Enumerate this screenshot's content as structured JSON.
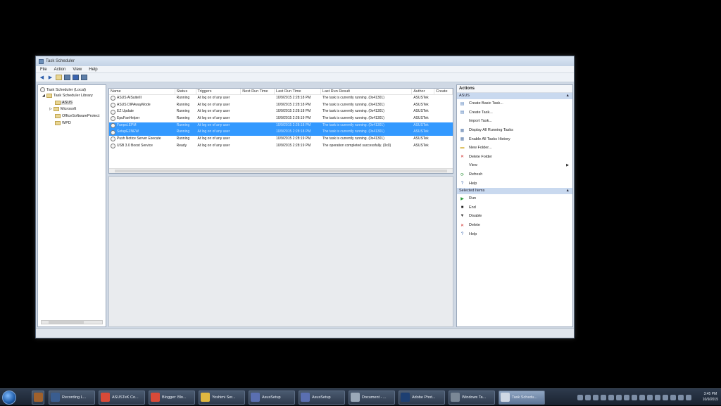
{
  "window": {
    "title": "Task Scheduler",
    "menu": [
      "File",
      "Action",
      "View",
      "Help"
    ]
  },
  "tree": {
    "root": "Task Scheduler (Local)",
    "library": "Task Scheduler Library",
    "folders": [
      "ASUS",
      "Microsoft",
      "OfficeSoftwareProtect",
      "WPD"
    ]
  },
  "table": {
    "columns": [
      "Name",
      "Status",
      "Triggers",
      "Next Run Time",
      "Last Run Time",
      "Last Run Result",
      "Author",
      "Create"
    ],
    "rows": [
      {
        "name": "ASUS AISuiteIII",
        "status": "Running",
        "triggers": "At log on of any user",
        "next": "",
        "last": "10/9/2015 2:28:18 PM",
        "result": "The task is currently running. (0x41301)",
        "author": "ASUSTek",
        "selected": false
      },
      {
        "name": "ASUS DIPAwayMode",
        "status": "Running",
        "triggers": "At log on of any user",
        "next": "",
        "last": "10/9/2015 2:28:18 PM",
        "result": "The task is currently running. (0x41301)",
        "author": "ASUSTek",
        "selected": false
      },
      {
        "name": "EZ Update",
        "status": "Running",
        "triggers": "At log on of any user",
        "next": "",
        "last": "10/9/2015 2:28:18 PM",
        "result": "The task is currently running. (0x41301)",
        "author": "ASUSTek",
        "selected": false
      },
      {
        "name": "EpuFanHelper",
        "status": "Running",
        "triggers": "At log on of any user",
        "next": "",
        "last": "10/9/2015 2:28:19 PM",
        "result": "The task is currently running. (0x41301)",
        "author": "ASUSTek",
        "selected": false
      },
      {
        "name": "FanpsLEPM",
        "status": "Running",
        "triggers": "At log on of any user",
        "next": "",
        "last": "10/9/2015 2:28:18 PM",
        "result": "The task is currently running. (0x41301)",
        "author": "ASUSTek",
        "selected": true
      },
      {
        "name": "SetupEZNEW",
        "status": "Running",
        "triggers": "At log on of any user",
        "next": "",
        "last": "10/9/2015 2:28:18 PM",
        "result": "The task is currently running. (0x41301)",
        "author": "ASUSTek",
        "selected": true
      },
      {
        "name": "Push Notice Server Execute",
        "status": "Running",
        "triggers": "At log on of any user",
        "next": "",
        "last": "10/9/2015 2:28:19 PM",
        "result": "The task is currently running. (0x41301)",
        "author": "ASUSTek",
        "selected": false
      },
      {
        "name": "USB 3.0 Boost Service",
        "status": "Ready",
        "triggers": "At log on of any user",
        "next": "",
        "last": "10/9/2015 2:28:19 PM",
        "result": "The operation completed successfully. (0x0)",
        "author": "ASUSTek",
        "selected": false
      }
    ]
  },
  "actions": {
    "title": "Actions",
    "section1": "ASUS",
    "items1": [
      {
        "label": "Create Basic Task...",
        "icon": "create-basic-task-icon"
      },
      {
        "label": "Create Task...",
        "icon": "create-task-icon"
      },
      {
        "label": "Import Task...",
        "icon": "import-task-icon"
      },
      {
        "label": "Display All Running Tasks",
        "icon": "running-tasks-icon"
      },
      {
        "label": "Enable All Tasks History",
        "icon": "history-icon"
      },
      {
        "label": "New Folder...",
        "icon": "new-folder-icon"
      },
      {
        "label": "Delete Folder",
        "icon": "delete-folder-icon"
      },
      {
        "label": "View",
        "icon": "view-icon"
      },
      {
        "label": "Refresh",
        "icon": "refresh-icon"
      },
      {
        "label": "Help",
        "icon": "help-icon"
      }
    ],
    "section2": "Selected Items",
    "items2": [
      {
        "label": "Run",
        "icon": "run-icon"
      },
      {
        "label": "End",
        "icon": "end-icon"
      },
      {
        "label": "Disable",
        "icon": "disable-icon"
      },
      {
        "label": "Delete",
        "icon": "delete-icon"
      },
      {
        "label": "Help",
        "icon": "help-icon"
      }
    ]
  },
  "taskbar": {
    "items": [
      "Recording L...",
      "ASUSTeK Co...",
      "Blogger: Blo...",
      "Yoshimi Ser...",
      "AsusSetup",
      "AsusSetup",
      "Document - ...",
      "Adobe Phot...",
      "Windows Ta...",
      "Task Schedu..."
    ],
    "time": "3:45 PM",
    "date": "10/9/2015"
  },
  "colors": {
    "selection": "#3399ff",
    "section_header": "#c9d9ef"
  }
}
